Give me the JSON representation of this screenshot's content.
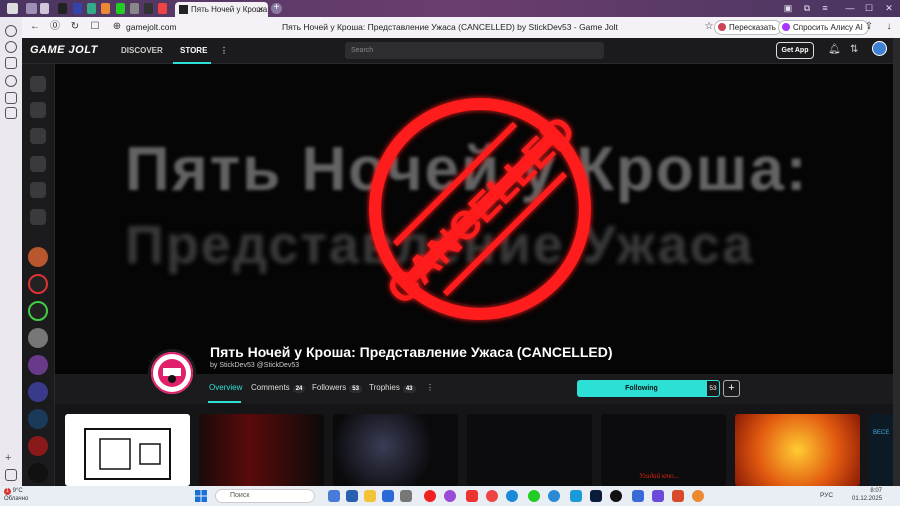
{
  "browser": {
    "tab_title": "Пять Ночей у Кроша: П",
    "url": "gamejolt.com",
    "page_title": "Пять Ночей у Кроша: Представление Ужаса (CANCELLED) by StickDev53 - Game Jolt",
    "translate_label": "Пересказать",
    "alice_label": "Спросить Алису AI"
  },
  "gj_nav": {
    "logo": "GAME JOLT",
    "discover": "DISCOVER",
    "store": "STORE",
    "search_placeholder": "Search",
    "get_app": "Get App"
  },
  "banner": {
    "bg_line1": "Пять Ночей у Кроша:",
    "bg_line2": "Представление Ужаса",
    "stamp_text": "CANCELLED"
  },
  "game": {
    "title": "Пять Ночей у Кроша: Представление Ужаса (CANCELLED)",
    "byline": "by StickDev53 @StickDev53"
  },
  "tabs": [
    {
      "label": "Overview",
      "count": ""
    },
    {
      "label": "Comments",
      "count": "24"
    },
    {
      "label": "Followers",
      "count": "53"
    },
    {
      "label": "Trophies",
      "count": "43"
    }
  ],
  "follow": {
    "label": "Following",
    "count": "53"
  },
  "media_caption": "Угадай кто...",
  "media_partial_text": "BECE",
  "taskbar": {
    "search_placeholder": "Поиск",
    "weather_temp": "9°C",
    "weather_desc": "Облачно",
    "lang": "РУС",
    "time": "8:07",
    "date": "01.12.2025",
    "notif_badge": "1"
  },
  "colors": {
    "accent": "#2de0d6",
    "stamp_red": "#ff1a1a"
  }
}
